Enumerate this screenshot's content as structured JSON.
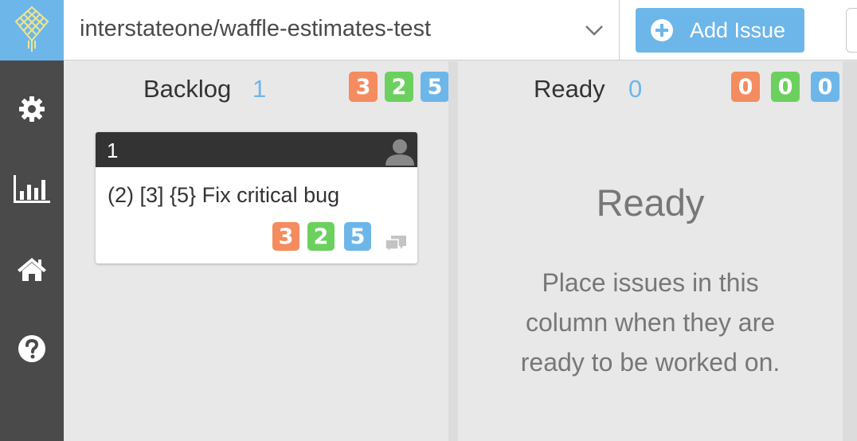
{
  "topbar": {
    "repo_name": "interstateone/waffle-estimates-test",
    "add_issue_label": "Add Issue"
  },
  "sidebar": {
    "icons": [
      "gear-icon",
      "bar-chart-icon",
      "home-icon",
      "help-icon"
    ]
  },
  "colors": {
    "accent": "#6db6ea",
    "sidebar": "#4a4a4a",
    "orange": "#f48c5f",
    "green": "#6cd05f",
    "blue": "#6db6ea"
  },
  "columns": [
    {
      "title": "Backlog",
      "count": "1",
      "estimates": [
        "3",
        "2",
        "5"
      ],
      "cards": [
        {
          "number": "1",
          "title": "(2) [3] {5} Fix critical bug",
          "estimates": [
            "3",
            "2",
            "5"
          ]
        }
      ]
    },
    {
      "title": "Ready",
      "count": "0",
      "estimates": [
        "0",
        "0",
        "0"
      ],
      "empty_title": "Ready",
      "empty_message": "Place issues in this column when they are ready to be worked on."
    }
  ]
}
